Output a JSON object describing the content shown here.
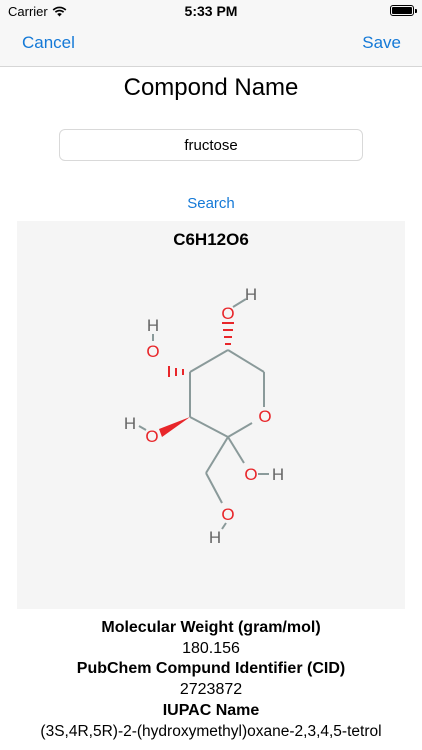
{
  "status_bar": {
    "carrier": "Carrier",
    "time": "5:33 PM"
  },
  "nav": {
    "cancel_label": "Cancel",
    "save_label": "Save"
  },
  "title": "Compond Name",
  "search": {
    "value": "fructose",
    "button_label": "Search"
  },
  "structure": {
    "formula": "C6H12O6",
    "atom_labels": {
      "oxygen": "O",
      "hydrogen": "H"
    }
  },
  "info": {
    "mw_label": "Molecular Weight (gram/mol)",
    "mw_value": "180.156",
    "cid_label": "PubChem Compund Identifier (CID)",
    "cid_value": "2723872",
    "iupac_label": "IUPAC Name",
    "iupac_value": "(3S,4R,5R)-2-(hydroxymethyl)oxane-2,3,4,5-tetrol"
  },
  "colors": {
    "accent": "#1479d7",
    "oxygen": "#e8262a",
    "bond": "#8a9a9a",
    "hydrogen": "#666666"
  }
}
